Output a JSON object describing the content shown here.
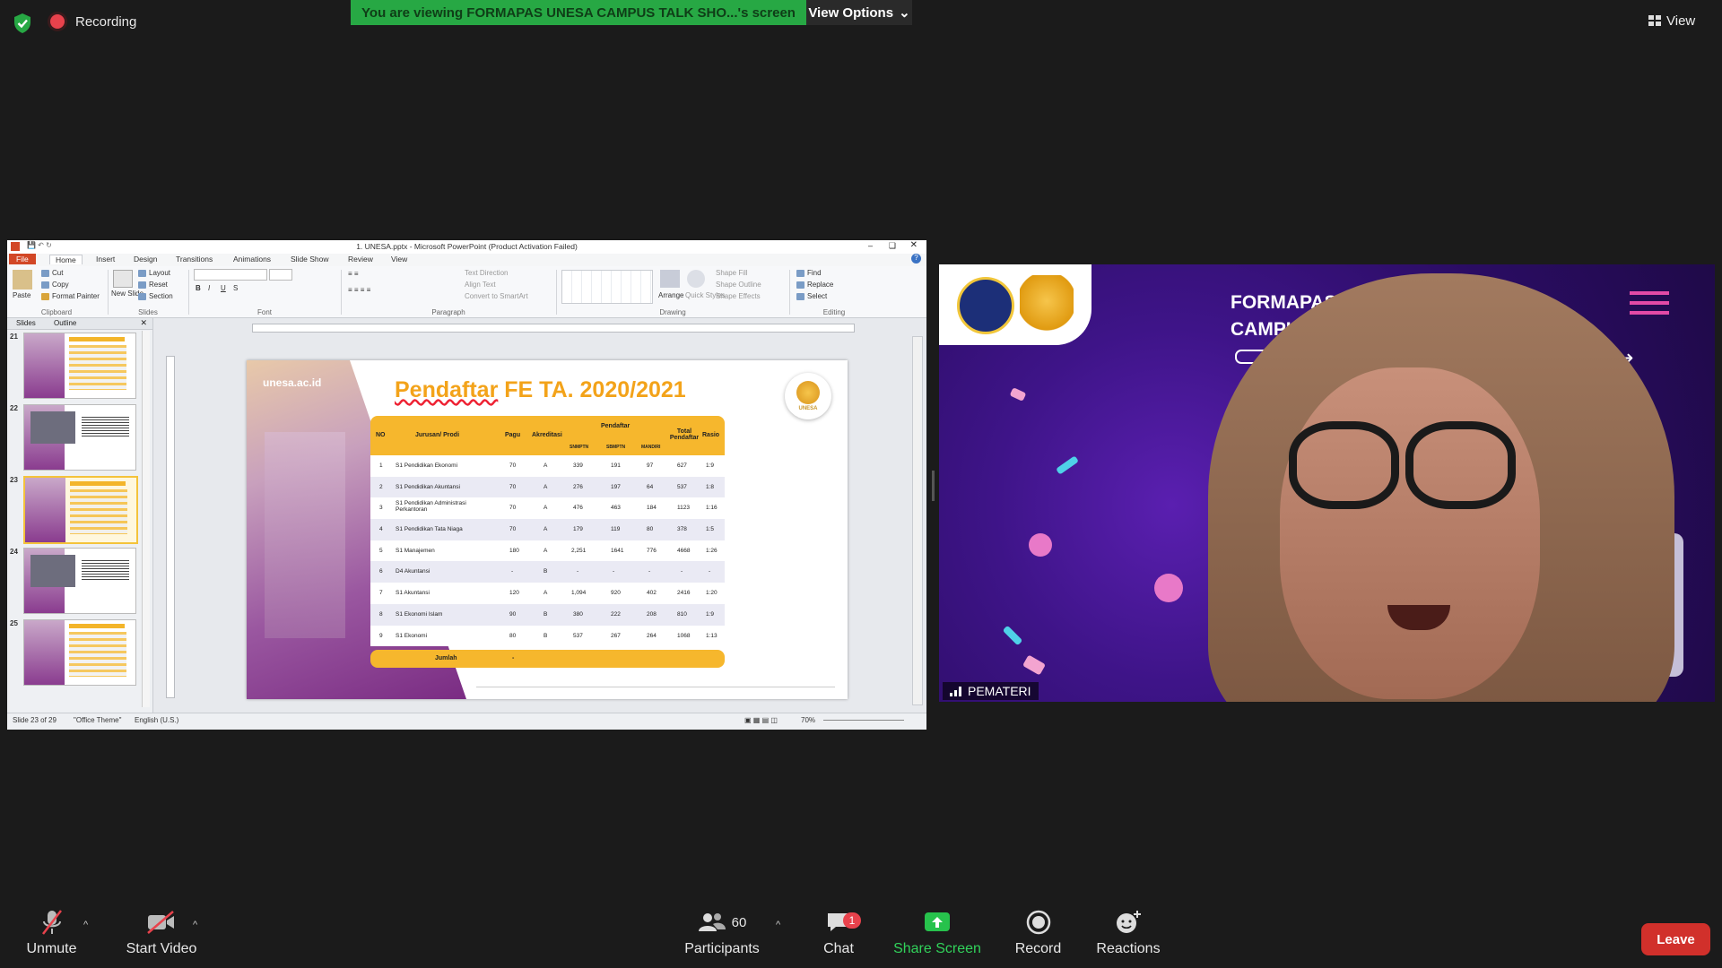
{
  "top": {
    "recording_label": "Recording",
    "banner_text": "You are viewing FORMAPAS UNESA CAMPUS TALK SHO...'s screen",
    "view_options_label": "View Options",
    "view_label": "View"
  },
  "ppt": {
    "title": "1. UNESA.pptx  -  Microsoft PowerPoint (Product Activation Failed)",
    "tabs": [
      "File",
      "Home",
      "Insert",
      "Design",
      "Transitions",
      "Animations",
      "Slide Show",
      "Review",
      "View"
    ],
    "ribbon": {
      "clipboard": {
        "paste": "Paste",
        "cut": "Cut",
        "copy": "Copy",
        "format_painter": "Format Painter",
        "label": "Clipboard"
      },
      "slides": {
        "new_slide": "New Slide",
        "layout": "Layout",
        "reset": "Reset",
        "section": "Section",
        "label": "Slides"
      },
      "font_label": "Font",
      "paragraph": {
        "text_direction": "Text Direction",
        "align_text": "Align Text",
        "convert": "Convert to SmartArt",
        "label": "Paragraph"
      },
      "drawing": {
        "arrange": "Arrange",
        "quick_styles": "Quick Styles",
        "shape_fill": "Shape Fill",
        "shape_outline": "Shape Outline",
        "shape_effects": "Shape Effects",
        "label": "Drawing"
      },
      "editing": {
        "find": "Find",
        "replace": "Replace",
        "select": "Select",
        "label": "Editing"
      }
    },
    "left_tabs": [
      "Slides",
      "Outline"
    ],
    "thumb_numbers": [
      "21",
      "22",
      "23",
      "24",
      "25"
    ],
    "status": {
      "slide": "Slide 23 of 29",
      "theme": "\"Office Theme\"",
      "lang": "English (U.S.)",
      "zoom": "70%"
    }
  },
  "slide": {
    "website": "unesa.ac.id",
    "title_a": "Pendaftar",
    "title_b": "FE TA. 2020/2021",
    "logo_text": "UNESA",
    "headers": {
      "no": "NO",
      "jurusan": "Jurusan/ Prodi",
      "pagu": "Pagu",
      "akreditasi": "Akreditasi",
      "pendaftar": "Pendaftar",
      "snmptn": "SNMPTN",
      "sbmptn": "SBMPTN",
      "mandiri": "MANDIRI",
      "total": "Total Pendaftar",
      "rasio": "Rasio"
    },
    "rows": [
      {
        "no": "1",
        "prodi": "S1 Pendidikan Ekonomi",
        "pagu": "70",
        "akr": "A",
        "snmptn": "339",
        "sbmptn": "191",
        "mandiri": "97",
        "total": "627",
        "rasio": "1:9"
      },
      {
        "no": "2",
        "prodi": "S1 Pendidikan Akuntansi",
        "pagu": "70",
        "akr": "A",
        "snmptn": "276",
        "sbmptn": "197",
        "mandiri": "64",
        "total": "537",
        "rasio": "1:8"
      },
      {
        "no": "3",
        "prodi": "S1 Pendidikan Administrasi Perkantoran",
        "pagu": "70",
        "akr": "A",
        "snmptn": "476",
        "sbmptn": "463",
        "mandiri": "184",
        "total": "1123",
        "rasio": "1:16"
      },
      {
        "no": "4",
        "prodi": "S1 Pendidikan Tata Niaga",
        "pagu": "70",
        "akr": "A",
        "snmptn": "179",
        "sbmptn": "119",
        "mandiri": "80",
        "total": "378",
        "rasio": "1:5"
      },
      {
        "no": "5",
        "prodi": "S1 Manajemen",
        "pagu": "180",
        "akr": "A",
        "snmptn": "2,251",
        "sbmptn": "1641",
        "mandiri": "776",
        "total": "4668",
        "rasio": "1:26"
      },
      {
        "no": "6",
        "prodi": "D4 Akuntansi",
        "pagu": "-",
        "akr": "B",
        "snmptn": "-",
        "sbmptn": "-",
        "mandiri": "-",
        "total": "-",
        "rasio": "-"
      },
      {
        "no": "7",
        "prodi": "S1 Akuntansi",
        "pagu": "120",
        "akr": "A",
        "snmptn": "1,094",
        "sbmptn": "920",
        "mandiri": "402",
        "total": "2416",
        "rasio": "1:20"
      },
      {
        "no": "8",
        "prodi": "S1 Ekonomi Islam",
        "pagu": "90",
        "akr": "B",
        "snmptn": "380",
        "sbmptn": "222",
        "mandiri": "208",
        "total": "810",
        "rasio": "1:9"
      },
      {
        "no": "9",
        "prodi": "S1 Ekonomi",
        "pagu": "80",
        "akr": "B",
        "snmptn": "537",
        "sbmptn": "267",
        "mandiri": "264",
        "total": "1068",
        "rasio": "1:13"
      }
    ],
    "footer_label": "Jumlah",
    "footer_value": "-"
  },
  "cam": {
    "title_line1": "FORMAPAS",
    "title_line2": "CAMPUS",
    "participant_name": "PEMATERI"
  },
  "toolbar": {
    "unmute": "Unmute",
    "start_video": "Start Video",
    "participants": "Participants",
    "participants_count": "60",
    "chat": "Chat",
    "chat_badge": "1",
    "share_screen": "Share Screen",
    "record": "Record",
    "reactions": "Reactions",
    "leave": "Leave"
  },
  "colors": {
    "banner": "#27a844",
    "leave": "#d1302b",
    "slide_accent": "#f6b72d",
    "share": "#27c24c"
  }
}
